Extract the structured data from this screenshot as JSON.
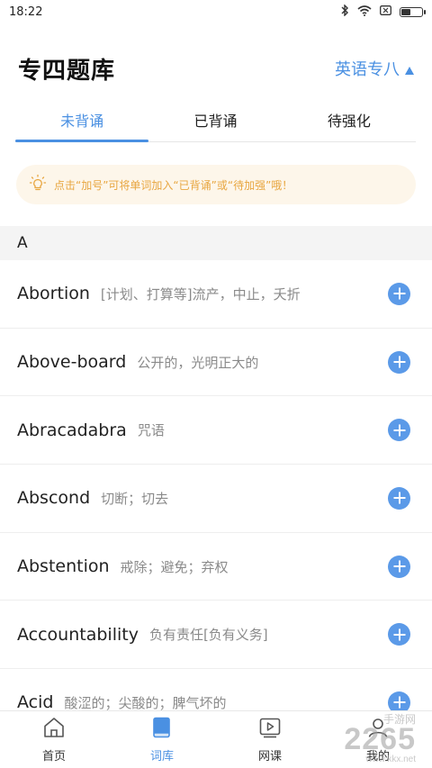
{
  "status_bar": {
    "time": "18:22",
    "icons": [
      "bluetooth-icon",
      "wifi-icon",
      "sim-icon",
      "battery-icon"
    ],
    "battery_level": 0.45
  },
  "header": {
    "title": "专四题库",
    "level_selector": "英语专八"
  },
  "tabs": [
    {
      "label": "未背诵",
      "active": true
    },
    {
      "label": "已背诵",
      "active": false
    },
    {
      "label": "待强化",
      "active": false
    }
  ],
  "tip": {
    "icon": "lightbulb-icon",
    "text": "点击“加号”可将单词加入“已背诵”或“待加强”哦！"
  },
  "section": {
    "letter": "A"
  },
  "words": [
    {
      "word": "Abortion",
      "meaning": "[计划、打算等]流产，中止，夭折"
    },
    {
      "word": "Above-board",
      "meaning": "公开的，光明正大的"
    },
    {
      "word": "Abracadabra",
      "meaning": "咒语"
    },
    {
      "word": "Abscond",
      "meaning": "切断；切去"
    },
    {
      "word": "Abstention",
      "meaning": "戒除；避免；弃权"
    },
    {
      "word": "Accountability",
      "meaning": "负有责任[负有义务]"
    },
    {
      "word": "Acid",
      "meaning": "酸涩的；尖酸的；脾气坏的"
    }
  ],
  "bottom_nav": [
    {
      "label": "首页",
      "icon": "home-icon",
      "active": false
    },
    {
      "label": "词库",
      "icon": "book-icon",
      "active": true
    },
    {
      "label": "网课",
      "icon": "video-icon",
      "active": false
    },
    {
      "label": "我的",
      "icon": "profile-icon",
      "active": false
    }
  ],
  "watermark": {
    "main": "2265",
    "site": "www.kkx.net",
    "tag": "手游网"
  },
  "colors": {
    "accent": "#4a90e2",
    "tip_bg": "#fdf6ea",
    "tip_text": "#e8a640",
    "add_button": "#5b9ae8"
  }
}
